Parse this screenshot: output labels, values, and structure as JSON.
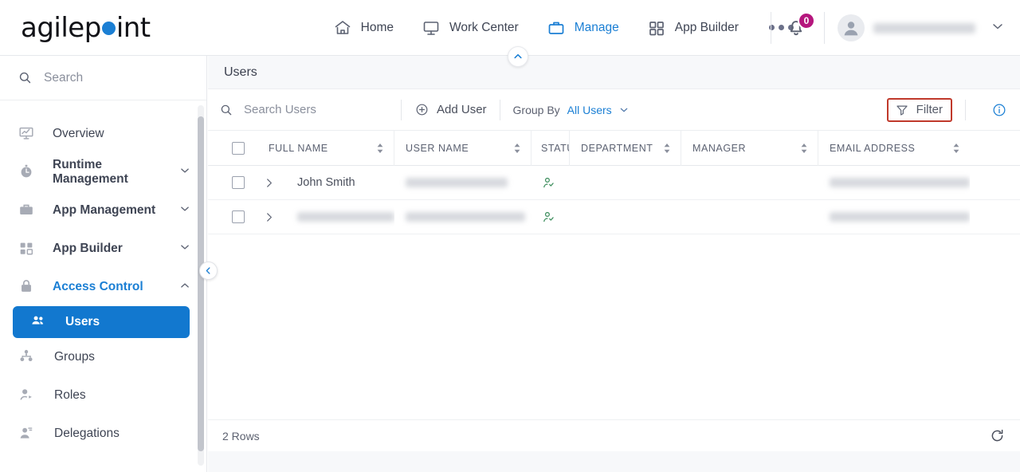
{
  "brand": {
    "name_part1": "agilep",
    "name_part2": "int",
    "dot_color": "#1b7fd4"
  },
  "topnav": {
    "items": [
      {
        "label": "Home",
        "icon": "home-icon",
        "active": false
      },
      {
        "label": "Work Center",
        "icon": "monitor-icon",
        "active": false
      },
      {
        "label": "Manage",
        "icon": "briefcase-icon",
        "active": true
      },
      {
        "label": "App Builder",
        "icon": "grid-icon",
        "active": false
      }
    ],
    "more_label": "...",
    "notifications_count": "0",
    "user_name": "",
    "badge_color": "#b5167d"
  },
  "sidebar": {
    "search_placeholder": "Search",
    "items": [
      {
        "label": "Overview",
        "icon": "chart-presentation-icon",
        "chevron": "",
        "state": "normal"
      },
      {
        "label": "Runtime Management",
        "icon": "stopwatch-icon",
        "chevron": "down",
        "state": "bold"
      },
      {
        "label": "App Management",
        "icon": "briefcase-icon",
        "chevron": "down",
        "state": "bold"
      },
      {
        "label": "App Builder",
        "icon": "grid-icon",
        "chevron": "down",
        "state": "bold"
      },
      {
        "label": "Access Control",
        "icon": "lock-icon",
        "chevron": "up",
        "state": "accent"
      },
      {
        "label": "Users",
        "icon": "users-icon",
        "chevron": "",
        "state": "selected"
      },
      {
        "label": "Groups",
        "icon": "group-icon",
        "chevron": "",
        "state": "sub"
      },
      {
        "label": "Roles",
        "icon": "role-user-icon",
        "chevron": "",
        "state": "sub"
      },
      {
        "label": "Delegations",
        "icon": "delegation-user-icon",
        "chevron": "",
        "state": "sub"
      }
    ]
  },
  "page": {
    "title": "Users"
  },
  "toolbar": {
    "search_placeholder": "Search Users",
    "add_user_label": "Add User",
    "group_by_label": "Group By",
    "group_by_value": "All Users",
    "filter_label": "Filter",
    "filter_highlight_color": "#c0392b",
    "info_label": "i"
  },
  "table": {
    "columns": [
      {
        "label": "FULL NAME",
        "sortable": true
      },
      {
        "label": "USER NAME",
        "sortable": true
      },
      {
        "label": "STATUS",
        "sortable": false
      },
      {
        "label": "DEPARTMENT",
        "sortable": true
      },
      {
        "label": "MANAGER",
        "sortable": true
      },
      {
        "label": "EMAIL ADDRESS",
        "sortable": true
      }
    ],
    "rows": [
      {
        "full_name": "John Smith",
        "full_name_redacted": false,
        "user_name": "",
        "user_name_redacted": true,
        "status_icon": "user-check-icon",
        "status_color": "#3f8f5f",
        "department": "",
        "manager": "",
        "email": "",
        "email_redacted": true
      },
      {
        "full_name": "",
        "full_name_redacted": true,
        "user_name": "",
        "user_name_redacted": true,
        "status_icon": "user-check-icon",
        "status_color": "#3f8f5f",
        "department": "",
        "manager": "",
        "email": "",
        "email_redacted": true
      }
    ],
    "footer_rows_label": "2 Rows"
  }
}
